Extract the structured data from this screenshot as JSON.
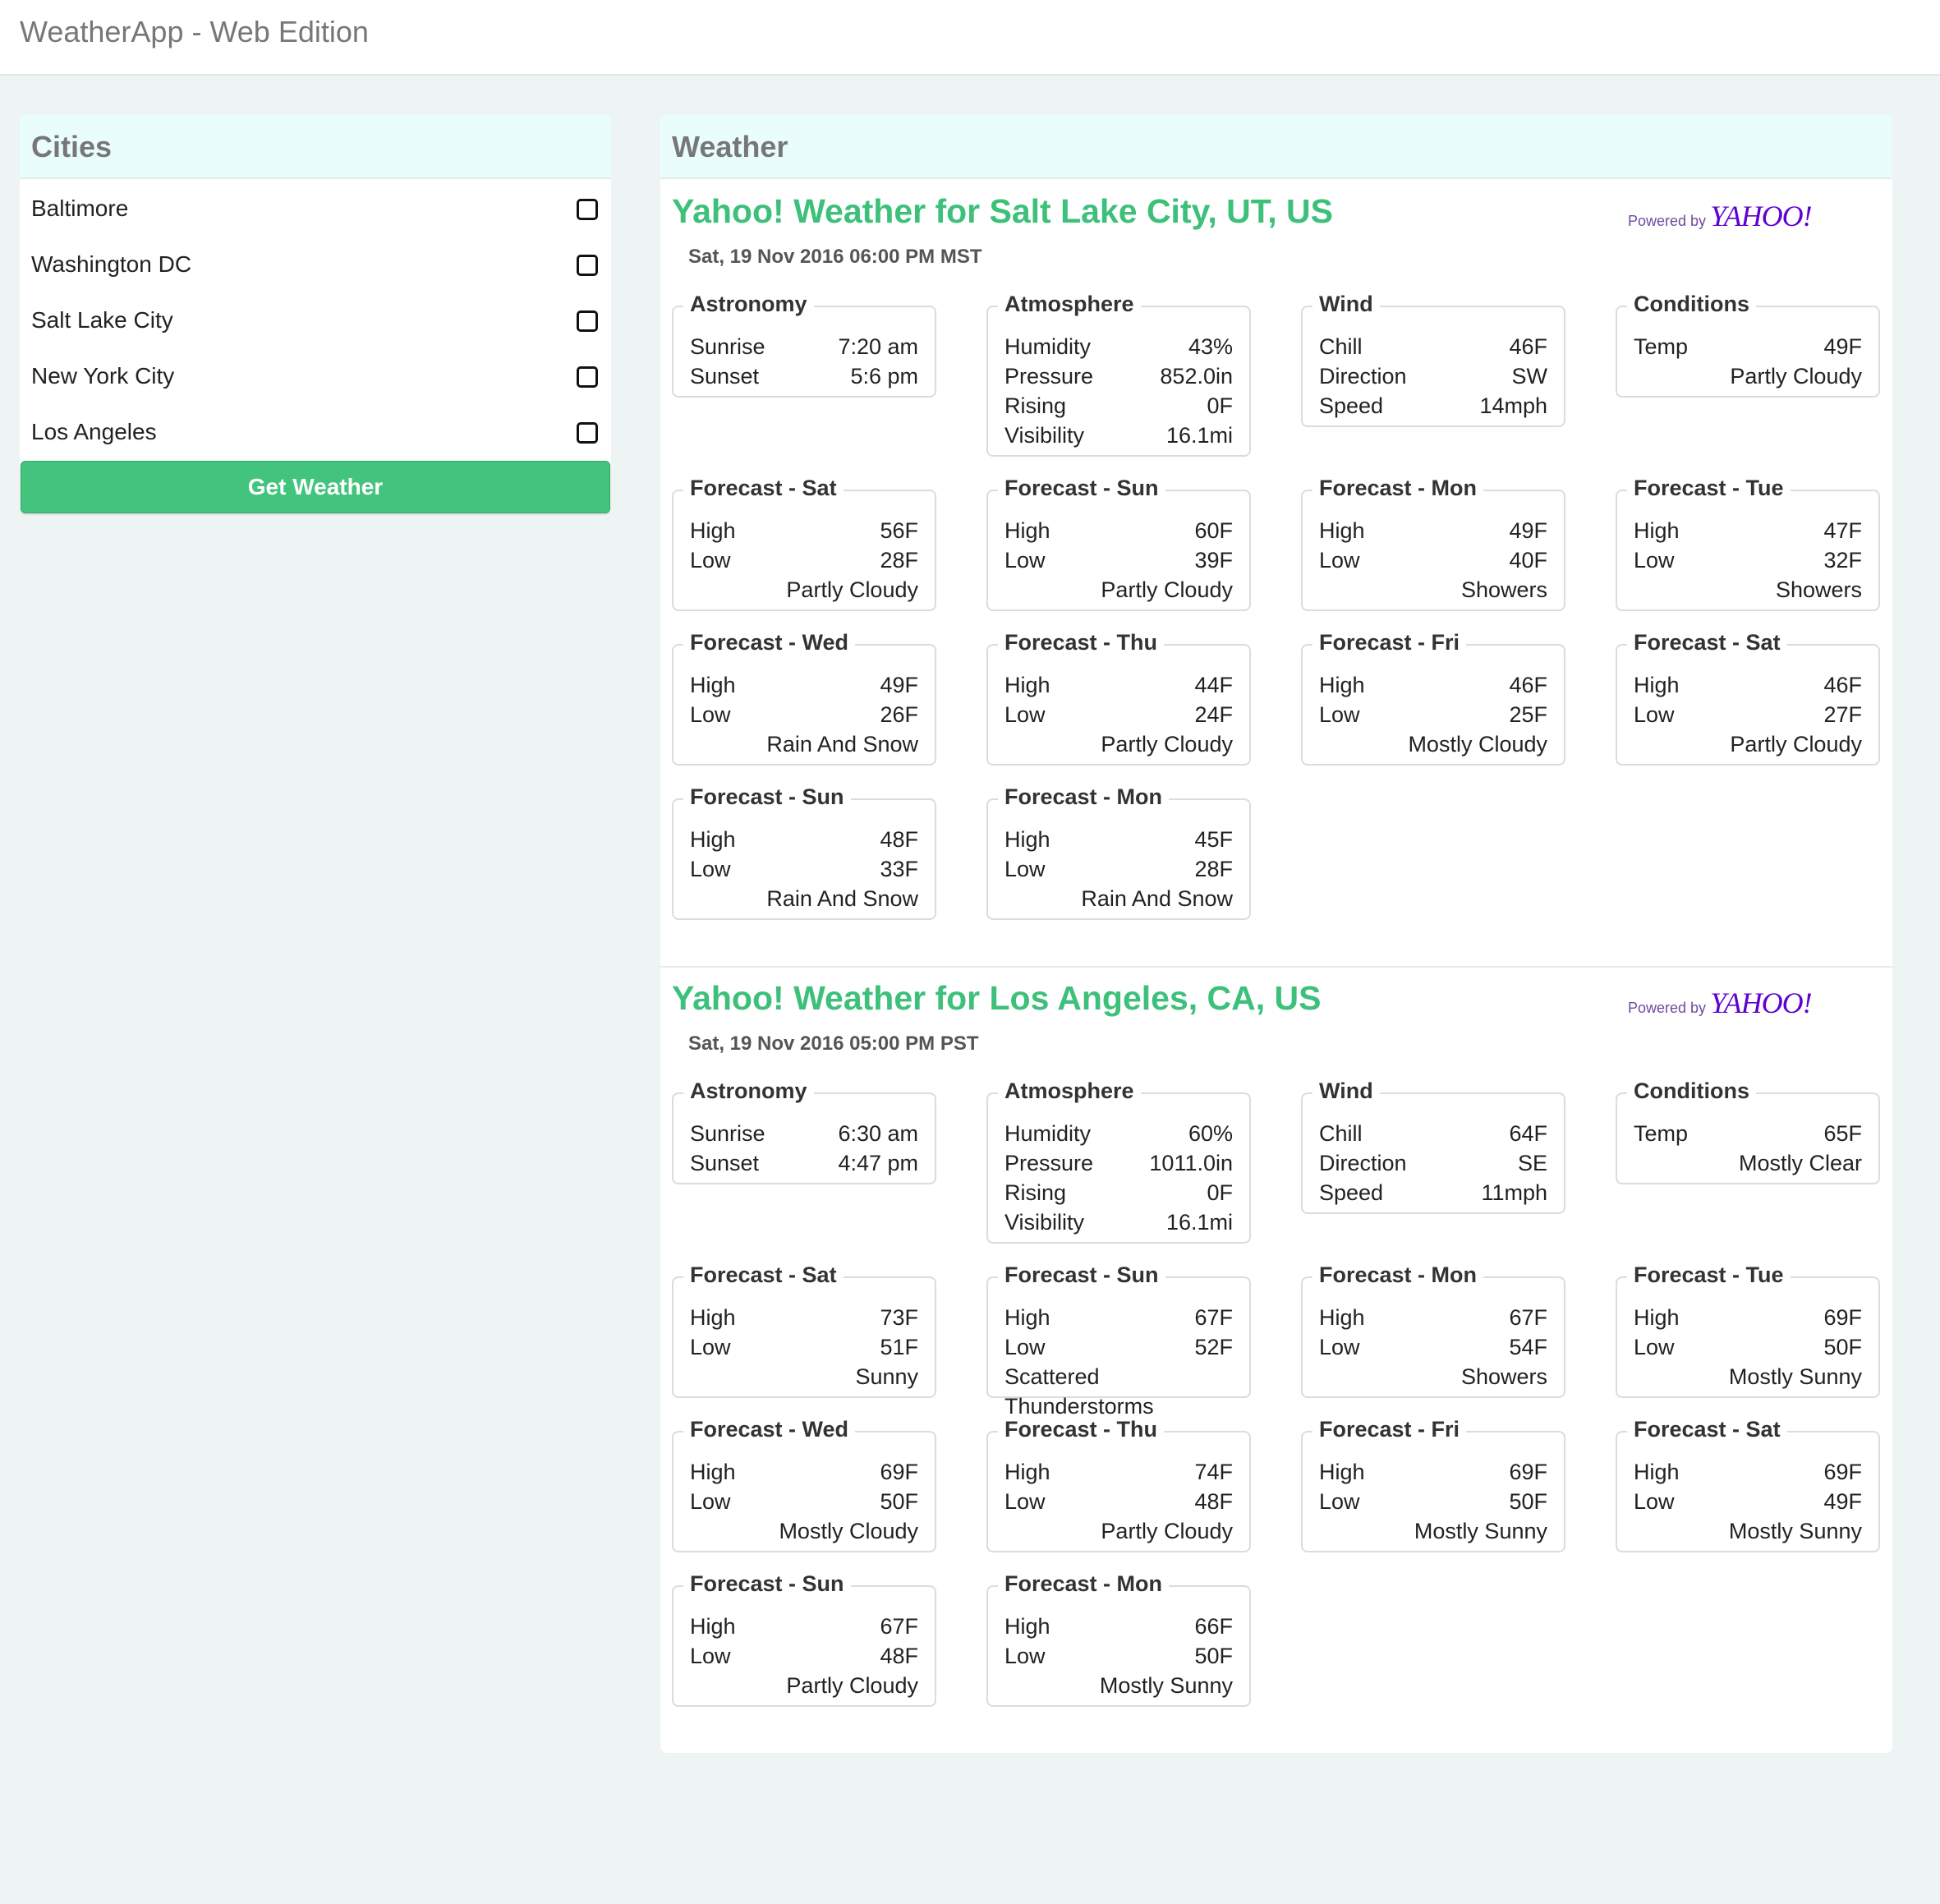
{
  "app": {
    "title": "WeatherApp - Web Edition"
  },
  "cities_panel": {
    "title": "Cities",
    "cities": [
      "Baltimore",
      "Washington DC",
      "Salt Lake City",
      "New York City",
      "Los Angeles"
    ],
    "button_label": "Get Weather",
    "button_color": "#42c47c"
  },
  "weather_panel": {
    "title": "Weather",
    "powered_by": "Powered by",
    "yahoo_brand": "YAHOO!",
    "reports": [
      {
        "title": "Yahoo! Weather for Salt Lake City, UT, US",
        "date": "Sat, 19 Nov 2016 06:00 PM MST",
        "astronomy": {
          "label": "Astronomy",
          "sunrise_label": "Sunrise",
          "sunrise": "7:20 am",
          "sunset_label": "Sunset",
          "sunset": "5:6 pm"
        },
        "atmosphere": {
          "label": "Atmosphere",
          "humidity_label": "Humidity",
          "humidity": "43%",
          "pressure_label": "Pressure",
          "pressure": "852.0in",
          "rising_label": "Rising",
          "rising": "0F",
          "visibility_label": "Visibility",
          "visibility": "16.1mi"
        },
        "wind": {
          "label": "Wind",
          "chill_label": "Chill",
          "chill": "46F",
          "direction_label": "Direction",
          "direction": "SW",
          "speed_label": "Speed",
          "speed": "14mph"
        },
        "conditions": {
          "label": "Conditions",
          "temp_label": "Temp",
          "temp": "49F",
          "text": "Partly Cloudy"
        },
        "forecast": [
          {
            "label": "Forecast - Sat",
            "high": "56F",
            "low": "28F",
            "text": "Partly Cloudy"
          },
          {
            "label": "Forecast - Sun",
            "high": "60F",
            "low": "39F",
            "text": "Partly Cloudy"
          },
          {
            "label": "Forecast - Mon",
            "high": "49F",
            "low": "40F",
            "text": "Showers"
          },
          {
            "label": "Forecast - Tue",
            "high": "47F",
            "low": "32F",
            "text": "Showers"
          },
          {
            "label": "Forecast - Wed",
            "high": "49F",
            "low": "26F",
            "text": "Rain And Snow"
          },
          {
            "label": "Forecast - Thu",
            "high": "44F",
            "low": "24F",
            "text": "Partly Cloudy"
          },
          {
            "label": "Forecast - Fri",
            "high": "46F",
            "low": "25F",
            "text": "Mostly Cloudy"
          },
          {
            "label": "Forecast - Sat",
            "high": "46F",
            "low": "27F",
            "text": "Partly Cloudy"
          },
          {
            "label": "Forecast - Sun",
            "high": "48F",
            "low": "33F",
            "text": "Rain And Snow"
          },
          {
            "label": "Forecast - Mon",
            "high": "45F",
            "low": "28F",
            "text": "Rain And Snow"
          }
        ]
      },
      {
        "title": "Yahoo! Weather for Los Angeles, CA, US",
        "date": "Sat, 19 Nov 2016 05:00 PM PST",
        "astronomy": {
          "label": "Astronomy",
          "sunrise_label": "Sunrise",
          "sunrise": "6:30 am",
          "sunset_label": "Sunset",
          "sunset": "4:47 pm"
        },
        "atmosphere": {
          "label": "Atmosphere",
          "humidity_label": "Humidity",
          "humidity": "60%",
          "pressure_label": "Pressure",
          "pressure": "1011.0in",
          "rising_label": "Rising",
          "rising": "0F",
          "visibility_label": "Visibility",
          "visibility": "16.1mi"
        },
        "wind": {
          "label": "Wind",
          "chill_label": "Chill",
          "chill": "64F",
          "direction_label": "Direction",
          "direction": "SE",
          "speed_label": "Speed",
          "speed": "11mph"
        },
        "conditions": {
          "label": "Conditions",
          "temp_label": "Temp",
          "temp": "65F",
          "text": "Mostly Clear"
        },
        "forecast": [
          {
            "label": "Forecast - Sat",
            "high": "73F",
            "low": "51F",
            "text": "Sunny"
          },
          {
            "label": "Forecast - Sun",
            "high": "67F",
            "low": "52F",
            "text": "Scattered Thunderstorms"
          },
          {
            "label": "Forecast - Mon",
            "high": "67F",
            "low": "54F",
            "text": "Showers"
          },
          {
            "label": "Forecast - Tue",
            "high": "69F",
            "low": "50F",
            "text": "Mostly Sunny"
          },
          {
            "label": "Forecast - Wed",
            "high": "69F",
            "low": "50F",
            "text": "Mostly Cloudy"
          },
          {
            "label": "Forecast - Thu",
            "high": "74F",
            "low": "48F",
            "text": "Partly Cloudy"
          },
          {
            "label": "Forecast - Fri",
            "high": "69F",
            "low": "50F",
            "text": "Mostly Sunny"
          },
          {
            "label": "Forecast - Sat",
            "high": "69F",
            "low": "49F",
            "text": "Mostly Sunny"
          },
          {
            "label": "Forecast - Sun",
            "high": "67F",
            "low": "48F",
            "text": "Partly Cloudy"
          },
          {
            "label": "Forecast - Mon",
            "high": "66F",
            "low": "50F",
            "text": "Mostly Sunny"
          }
        ],
        "forecast_high_label": "High",
        "forecast_low_label": "Low"
      }
    ],
    "high_label": "High",
    "low_label": "Low"
  }
}
